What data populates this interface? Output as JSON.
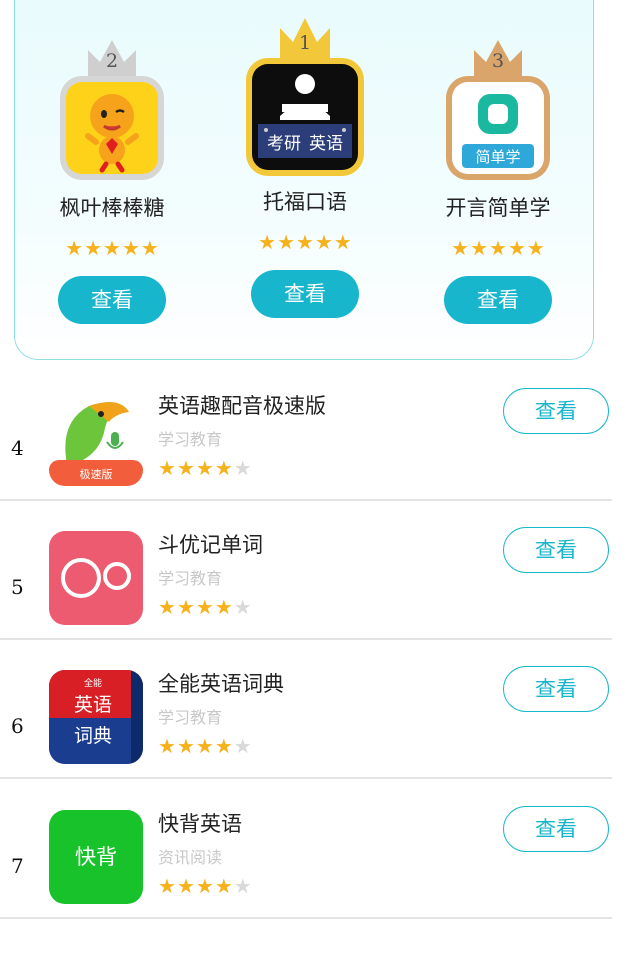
{
  "podium": [
    {
      "rank": "2",
      "name": "枫叶棒棒糖",
      "stars": 5,
      "button": "查看",
      "icon": "cartoon-baby-icon",
      "crown_color": "#c9c9c9"
    },
    {
      "rank": "1",
      "name": "托福口语",
      "stars": 5,
      "button": "查看",
      "icon": "kaoyan-english-icon",
      "icon_text_left": "考研",
      "icon_text_right": "英语",
      "crown_color": "#f2c83a"
    },
    {
      "rank": "3",
      "name": "开言简单学",
      "stars": 5,
      "button": "查看",
      "icon": "jiandanxue-icon",
      "icon_text": "简单学",
      "crown_color": "#d9a56b"
    }
  ],
  "list": [
    {
      "rank": "4",
      "name": "英语趣配音极速版",
      "category": "学习教育",
      "stars": 4,
      "button": "查看",
      "icon": "parrot-mic-icon",
      "icon_text": "极速版"
    },
    {
      "rank": "5",
      "name": "斗优记单词",
      "category": "学习教育",
      "stars": 4,
      "button": "查看",
      "icon": "two-circles-icon"
    },
    {
      "rank": "6",
      "name": "全能英语词典",
      "category": "学习教育",
      "stars": 4,
      "button": "查看",
      "icon": "dictionary-book-icon",
      "icon_text_top": "全能",
      "icon_text_mid": "英语",
      "icon_text_bot": "词典"
    },
    {
      "rank": "7",
      "name": "快背英语",
      "category": "资讯阅读",
      "stars": 4,
      "button": "查看",
      "icon": "kuaibei-icon",
      "icon_text": "快背"
    }
  ],
  "colors": {
    "accent": "#17b6cc",
    "star": "#f5b21c",
    "star_off": "#d9d9d9"
  }
}
